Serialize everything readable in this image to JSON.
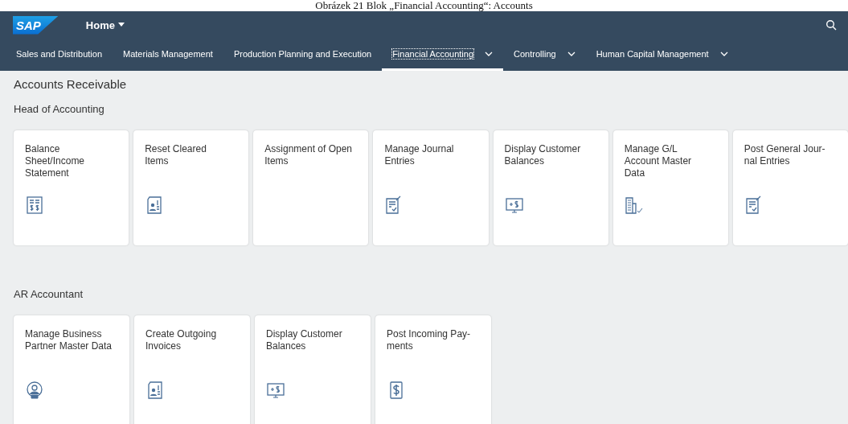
{
  "caption": "Obrázek 21 Blok „Financial Accounting“: Accounts",
  "shell": {
    "logo": "SAP",
    "title": "Home"
  },
  "nav": [
    {
      "label": "Sales and Distribution",
      "selected": false,
      "menu": false
    },
    {
      "label": "Materials Management",
      "selected": false,
      "menu": false
    },
    {
      "label": "Production Planning and Execution",
      "selected": false,
      "menu": false
    },
    {
      "label": "Financial Accounting",
      "selected": true,
      "menu": true
    },
    {
      "label": "Controlling",
      "selected": false,
      "menu": true
    },
    {
      "label": "Human Capital Management",
      "selected": false,
      "menu": true
    }
  ],
  "page_title": "Accounts Receivable",
  "groups": [
    {
      "title": "Head of Accounting",
      "tiles": [
        {
          "title": "Balance Sheet/Income Statement",
          "kind": "report"
        },
        {
          "title": "Reset Cleared Items",
          "kind": "docperson"
        },
        {
          "title": "Assignment of Open Items",
          "kind": "plain"
        },
        {
          "title": "Manage Journal Entries",
          "kind": "journal"
        },
        {
          "title": "Display Customer Balances",
          "kind": "monitor"
        },
        {
          "title": "Manage G/L Account Master Data",
          "kind": "building"
        },
        {
          "title": "Post General Jour-\nnal Entries",
          "kind": "journal"
        }
      ]
    },
    {
      "title": "AR Accountant",
      "tiles": [
        {
          "title": "Manage Business Partner Master Data",
          "kind": "person"
        },
        {
          "title": "Create Outgoing Invoices",
          "kind": "docperson"
        },
        {
          "title": "Display Customer Balances",
          "kind": "monitor"
        },
        {
          "title": "Post Incoming Pay-\nments",
          "kind": "dollar"
        }
      ]
    }
  ]
}
